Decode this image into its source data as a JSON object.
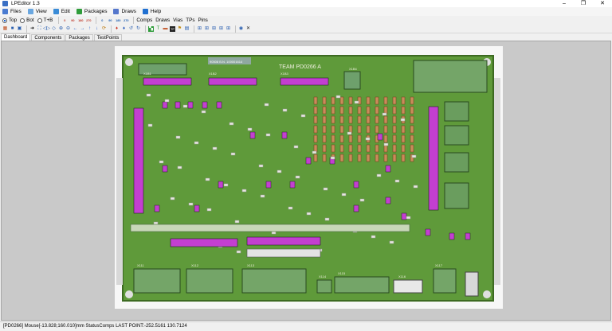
{
  "window": {
    "title": "LPEditor 1.3",
    "controls": [
      "–",
      "❐",
      "✕"
    ]
  },
  "menu": [
    {
      "label": "Files",
      "icon": "files-icon",
      "color": "#4a7bd1"
    },
    {
      "label": "View",
      "icon": "view-icon",
      "color": "#6aa7e0"
    },
    {
      "label": "Edit",
      "icon": "edit-icon",
      "color": "#3a8bd6"
    },
    {
      "label": "Packages",
      "icon": "packages-icon",
      "color": "#2f9c3a"
    },
    {
      "label": "Draws",
      "icon": "draws-icon",
      "color": "#5577cc"
    },
    {
      "label": "Help",
      "icon": "help-icon",
      "color": "#1f6fd1"
    }
  ],
  "toolbar1": {
    "side_top": "Top",
    "side_bot": "Bot",
    "side_both": "T+B",
    "chips": [
      "0",
      "90",
      "180",
      "270",
      "0",
      "90",
      "180",
      "270"
    ],
    "filters": [
      "Comps",
      "Draws",
      "Vias",
      "TPs",
      "Pins"
    ]
  },
  "tabs": [
    "Dashboard",
    "Components",
    "Packages",
    "TestPoints"
  ],
  "board": {
    "team_label": "TEAM PD0266 A",
    "sticker_text": "90508 B.N. 100001614",
    "connectors": [
      "X1B1",
      "X1B2",
      "X1B3",
      "X1B4",
      "X111",
      "X112",
      "X113",
      "X114",
      "X115",
      "X116",
      "X117"
    ]
  },
  "status": {
    "text": "[PD0266]  Mouse[-13.828;160.010]mm  StatusComps  LAST POINT:-252.5161 130.7124"
  },
  "colors": {
    "board_green": "#5f9a3a",
    "pad_magenta": "#c33fd1",
    "silk": "#e8e8e0",
    "resistor": "#c98b5a"
  }
}
